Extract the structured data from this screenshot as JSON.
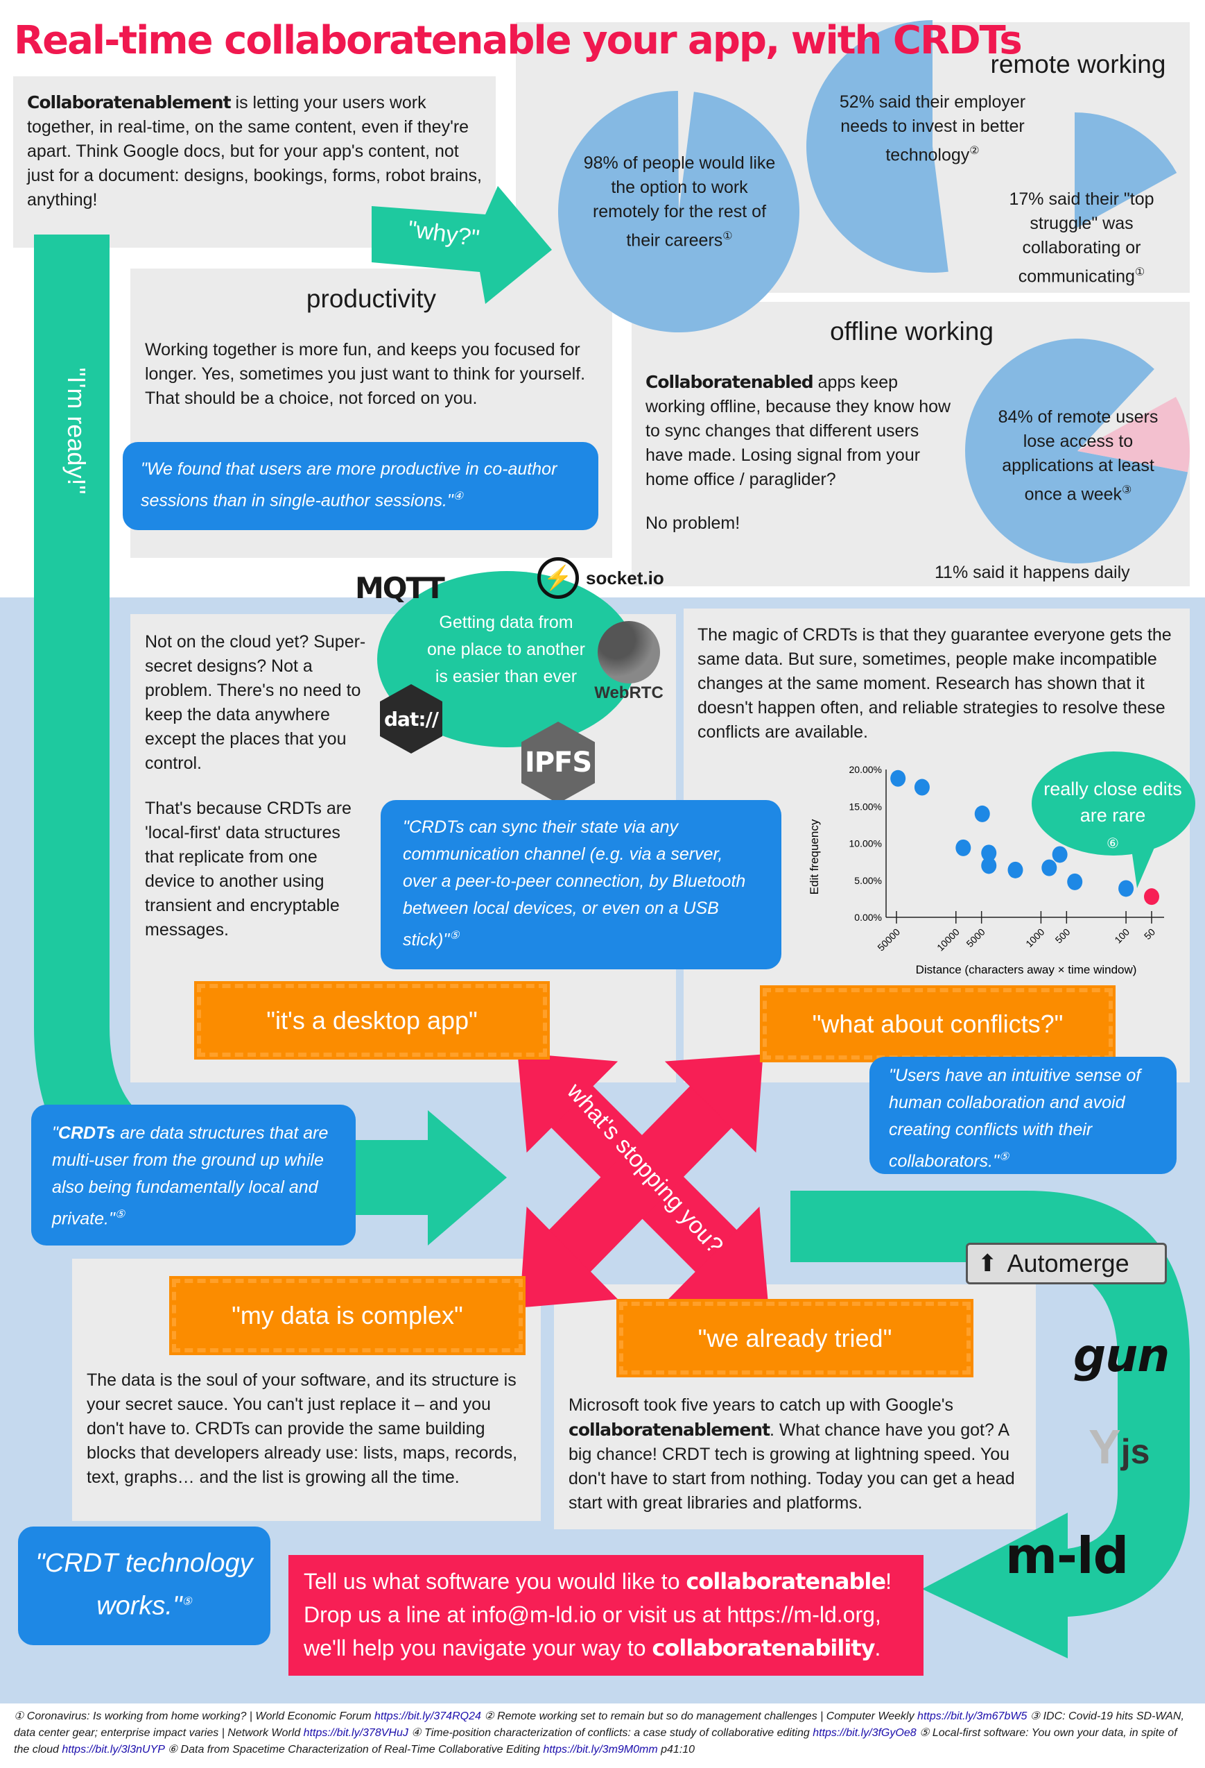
{
  "title": "Real-time collaboratenable your app, with CRDTs",
  "colors": {
    "title": "#f0184f",
    "green": "#1ec99f",
    "blue": "#1e88e5",
    "orange": "#fb8c00",
    "red": "#f71f55",
    "pie": "#85b9e3",
    "pink": "#f3c0cf",
    "panel": "#ebebeb",
    "background": "#c5d9ee"
  },
  "intro": {
    "bold": "Collaboratenablement",
    "text": " is letting your users work together, in real-time, on the same content, even if they're apart. Think Google docs, but for your app's content, not just for a document: designs, bookings, forms, robot brains, anything!"
  },
  "why": "\"why?\"",
  "ready": "\"I'm ready!\"",
  "remote": {
    "heading": "remote working",
    "stat1": {
      "text": "98% of people would like the option to work remotely for the rest of their careers",
      "ref": "①",
      "value": 98
    },
    "stat2": {
      "text": "52% said their employer needs to invest in better technology",
      "ref": "②",
      "value": 52
    },
    "stat3": {
      "text": "17% said their \"top struggle\" was collaborating or communicating",
      "ref": "①",
      "value": 17
    }
  },
  "productivity": {
    "heading": "productivity",
    "text": "Working together is more fun, and keeps you focused for longer. Yes, sometimes you just want to think for yourself. That should be a choice, not forced on you.",
    "quote": "\"We found that users are more productive in co-author sessions than in single-author sessions.\"",
    "ref": "④"
  },
  "offline": {
    "heading": "offline working",
    "bold": "Collaboratenabled",
    "text": " apps keep working offline, because they know how to sync changes that different users have made. Losing signal from your home office / paraglider?",
    "text2": "No problem!",
    "stat": {
      "text": "84% of remote users lose access to applications at least once a week",
      "ref": "③",
      "value": 84
    },
    "daily": {
      "text": "11% said it happens daily",
      "value": 11
    }
  },
  "cloud": {
    "p1": "Not on the cloud yet? Super-secret designs? Not a problem. There's no need to keep the data anywhere except the places that you control.",
    "p2": "That's because CRDTs are 'local-first' data structures that replicate from one device to another using transient and encryptable messages."
  },
  "transport": {
    "bubble": "Getting data from one place to another is easier than ever",
    "logos": [
      "MQTT",
      "socket.io",
      "WebRTC",
      "dat://",
      "IPFS"
    ]
  },
  "sync_quote": {
    "text": "\"CRDTs can sync their state via any communication channel (e.g. via a server, over a peer-to-peer connection, by Bluetooth between local devices, or even on a USB stick)\"",
    "ref": "⑤"
  },
  "magic": "The magic of CRDTs is that they guarantee everyone gets the same data. But sure, sometimes, people make incompatible changes at the same moment. Research has shown that it doesn't happen often, and reliable strategies to resolve these conflicts are available.",
  "chart_callout": {
    "text": "really close edits are rare",
    "ref": "⑥"
  },
  "chart_data": {
    "type": "scatter",
    "xlabel": "Distance (characters away × time window)",
    "ylabel": "Edit frequency",
    "x_scale": "log",
    "x_reversed": true,
    "xticks": [
      50000,
      10000,
      5000,
      1000,
      500,
      100,
      50
    ],
    "yticks": [
      "0.00%",
      "5.00%",
      "10.00%",
      "15.00%",
      "20.00%"
    ],
    "ylim": [
      0,
      20
    ],
    "points": [
      {
        "x": 48000,
        "y": 18.8
      },
      {
        "x": 25000,
        "y": 17.6
      },
      {
        "x": 4900,
        "y": 14.0
      },
      {
        "x": 8200,
        "y": 9.4
      },
      {
        "x": 4100,
        "y": 8.7
      },
      {
        "x": 4100,
        "y": 7.0
      },
      {
        "x": 2000,
        "y": 6.4
      },
      {
        "x": 800,
        "y": 6.7
      },
      {
        "x": 600,
        "y": 8.5
      },
      {
        "x": 400,
        "y": 4.8
      },
      {
        "x": 100,
        "y": 3.9
      },
      {
        "x": 50,
        "y": 2.8,
        "highlight": true
      }
    ]
  },
  "objections": {
    "desktop": "\"it's a desktop app\"",
    "conflicts": "\"what about conflicts?\"",
    "complex": "\"my data is complex\"",
    "tried": "\"we already tried\"",
    "center": "what's stopping you?"
  },
  "conflicts_quote": {
    "text": "\"Users have an intuitive sense of human collaboration and avoid creating conflicts with their collaborators.\"",
    "ref": "⑤"
  },
  "crdt_quote": {
    "bold": "CRDTs",
    "text": " are data structures that are multi-user from the ground up while also being fundamentally local and private.\"",
    "open": "\"",
    "ref": "⑤"
  },
  "complex_text": "The data is the soul of your software, and its structure is your secret sauce. You can't just replace it – and you don't have to. CRDTs can provide the same building blocks that developers already use: lists, maps, records, text, graphs… and the list is growing all the time.",
  "tried_text": {
    "a": "Microsoft took five years to catch up with Google's ",
    "bold": "collaboratenablement",
    "b": ". What chance have you got? A big chance! CRDT tech is growing at lightning speed. You don't have to start from nothing. Today you can get a head start with great libraries and platforms."
  },
  "libraries": {
    "automerge": "Automerge",
    "gun": "gun",
    "yjs": "js",
    "mld": "m-ld"
  },
  "works_quote": {
    "text": "\"CRDT technology works.\"",
    "ref": "⑤"
  },
  "cta": {
    "a": "Tell us what software you would like to ",
    "b1": "collaboratenable",
    "c": "!",
    "d": "Drop us a line at ",
    "email": "info@m-ld.io",
    "e": " or visit us at ",
    "url": "https://m-ld.org",
    "f": ",",
    "g": "we'll help you navigate your way to ",
    "b2": "collaboratenability",
    "h": "."
  },
  "footnotes": [
    {
      "n": "①",
      "t": "Coronavirus: Is working from home working? | World Economic Forum ",
      "link": "https://bit.ly/374RQ24"
    },
    {
      "n": "②",
      "t": "Remote working set to remain but so do management challenges | Computer Weekly ",
      "link": "https://bit.ly/3m67bW5"
    },
    {
      "n": "③",
      "t": "IDC: Covid-19 hits SD-WAN, data center gear; enterprise impact varies | Network World ",
      "link": "https://bit.ly/378VHuJ"
    },
    {
      "n": "④",
      "t": "Time-position characterization of conflicts: a case study of collaborative editing ",
      "link": "https://bit.ly/3fGyOe8"
    },
    {
      "n": "⑤",
      "t": "Local-first software: You own your data, in spite of the cloud ",
      "link": "https://bit.ly/3l3nUYP"
    },
    {
      "n": "⑥",
      "t": "Data from Spacetime Characterization of Real-Time Collaborative Editing ",
      "link": "https://bit.ly/3m9M0mm",
      "tail": " p41:10"
    }
  ]
}
